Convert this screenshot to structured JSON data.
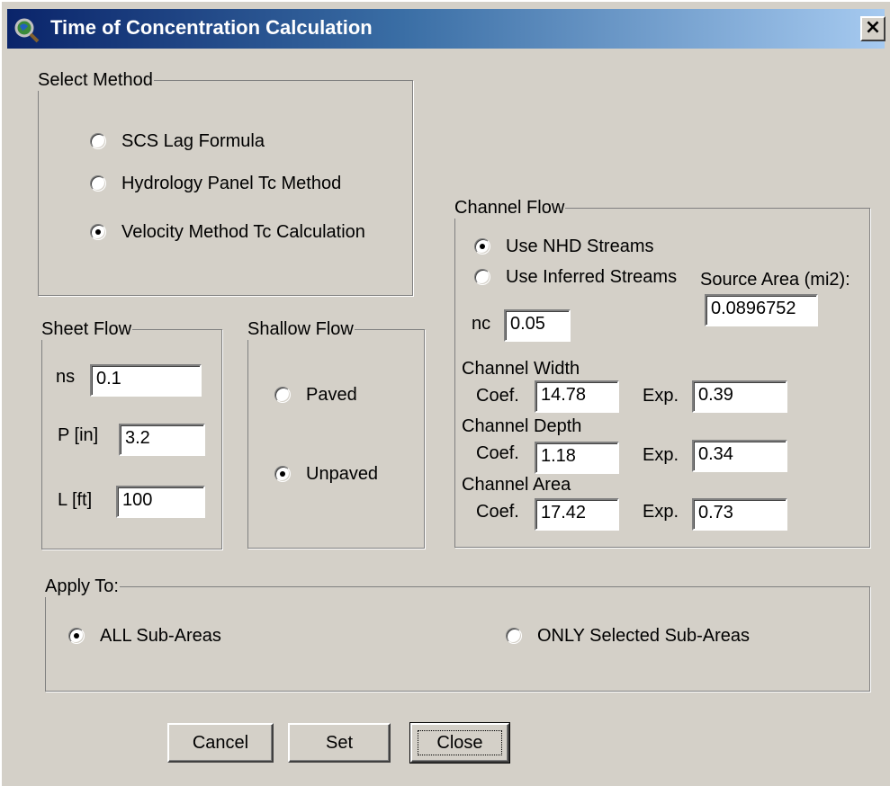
{
  "window": {
    "title": "Time of Concentration Calculation"
  },
  "select_method": {
    "legend": "Select Method",
    "options": [
      {
        "label": "SCS Lag Formula",
        "selected": false
      },
      {
        "label": "Hydrology Panel Tc Method",
        "selected": false
      },
      {
        "label": "Velocity Method Tc Calculation",
        "selected": true
      }
    ]
  },
  "sheet_flow": {
    "legend": "Sheet Flow",
    "ns_label": "ns",
    "ns_value": "0.1",
    "p_label": "P [in]",
    "p_value": "3.2",
    "l_label": "L [ft]",
    "l_value": "100"
  },
  "shallow_flow": {
    "legend": "Shallow Flow",
    "options": [
      {
        "label": "Paved",
        "selected": false
      },
      {
        "label": "Unpaved",
        "selected": true
      }
    ]
  },
  "channel_flow": {
    "legend": "Channel Flow",
    "options": [
      {
        "label": "Use NHD Streams",
        "selected": true
      },
      {
        "label": "Use Inferred Streams",
        "selected": false
      }
    ],
    "source_area_label": "Source Area (mi2):",
    "source_area_value": "0.0896752",
    "nc_label": "nc",
    "nc_value": "0.05",
    "coef_label": "Coef.",
    "exp_label": "Exp.",
    "width": {
      "label": "Channel Width",
      "coef": "14.78",
      "exp": "0.39"
    },
    "depth": {
      "label": "Channel Depth",
      "coef": "1.18",
      "exp": "0.34"
    },
    "area": {
      "label": "Channel Area",
      "coef": "17.42",
      "exp": "0.73"
    }
  },
  "apply_to": {
    "legend": "Apply To:",
    "options": [
      {
        "label": "ALL Sub-Areas",
        "selected": true
      },
      {
        "label": "ONLY Selected Sub-Areas",
        "selected": false
      }
    ]
  },
  "buttons": {
    "cancel": "Cancel",
    "set": "Set",
    "close": "Close"
  },
  "icons": {
    "app": "magnifier-globe-icon",
    "close": "close-x-icon"
  },
  "colors": {
    "title_start": "#0a246a",
    "title_end": "#a6caf0",
    "face": "#d4d0c8"
  }
}
